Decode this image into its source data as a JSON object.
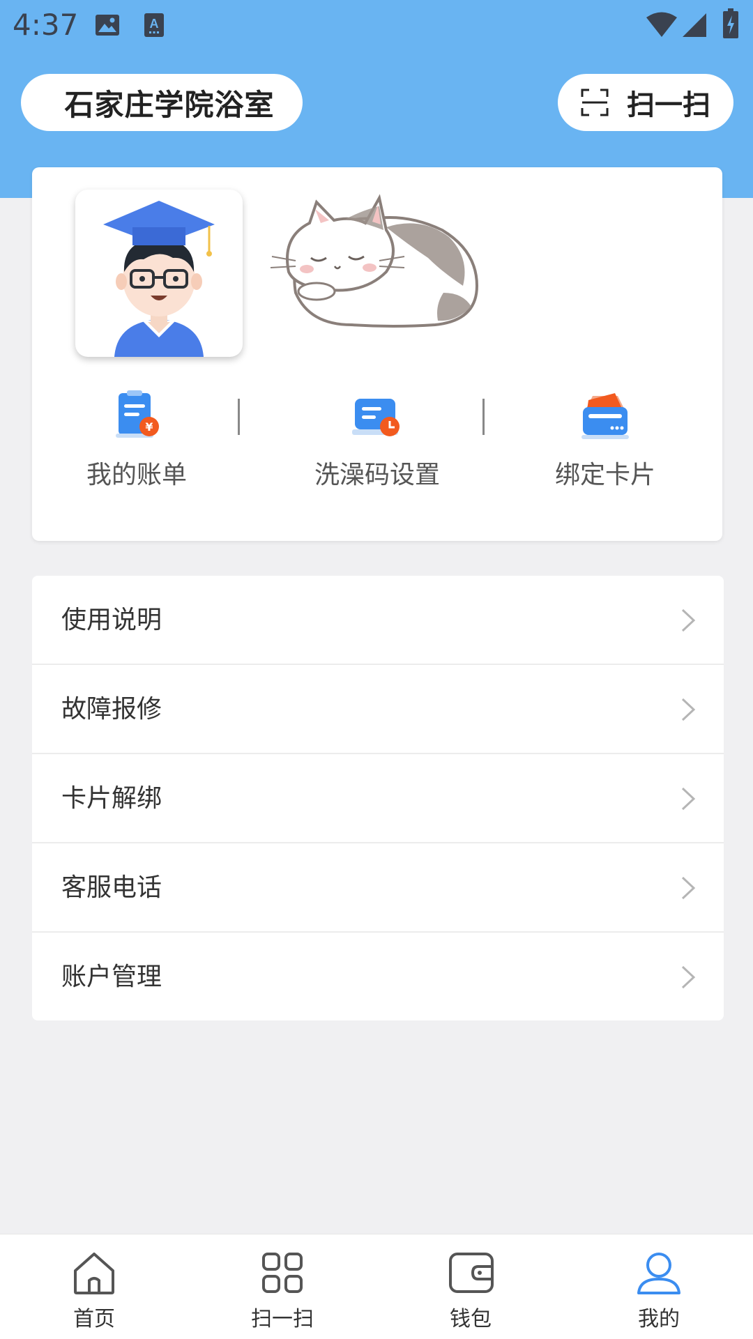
{
  "status_bar": {
    "time": "4:37",
    "icons": [
      "image-icon",
      "keyboard-a-icon",
      "wifi-icon",
      "signal-icon",
      "battery-icon"
    ]
  },
  "header": {
    "school_name": "石家庄学院浴室",
    "scan_label": "扫一扫",
    "scan_icon": "scan-frame-icon",
    "background_color": "#69b4f2"
  },
  "profile": {
    "avatar_icon": "graduate-avatar-icon",
    "decoration_icon": "sleeping-cat-illustration"
  },
  "quick_actions": [
    {
      "label": "我的账单",
      "icon": "bill-icon"
    },
    {
      "label": "洗澡码设置",
      "icon": "bath-code-settings-icon"
    },
    {
      "label": "绑定卡片",
      "icon": "bind-card-icon"
    }
  ],
  "menu": [
    {
      "label": "使用说明"
    },
    {
      "label": "故障报修"
    },
    {
      "label": "卡片解绑"
    },
    {
      "label": "客服电话"
    },
    {
      "label": "账户管理"
    }
  ],
  "bottom_nav": [
    {
      "label": "首页",
      "icon": "home-icon",
      "active": false
    },
    {
      "label": "扫一扫",
      "icon": "grid-scan-icon",
      "active": false
    },
    {
      "label": "钱包",
      "icon": "wallet-icon",
      "active": false
    },
    {
      "label": "我的",
      "icon": "user-icon",
      "active": true
    }
  ],
  "colors": {
    "accent": "#3b8df0",
    "header_bg": "#69b4f2",
    "page_bg": "#f0f0f2",
    "badge_orange": "#f25a1f"
  }
}
